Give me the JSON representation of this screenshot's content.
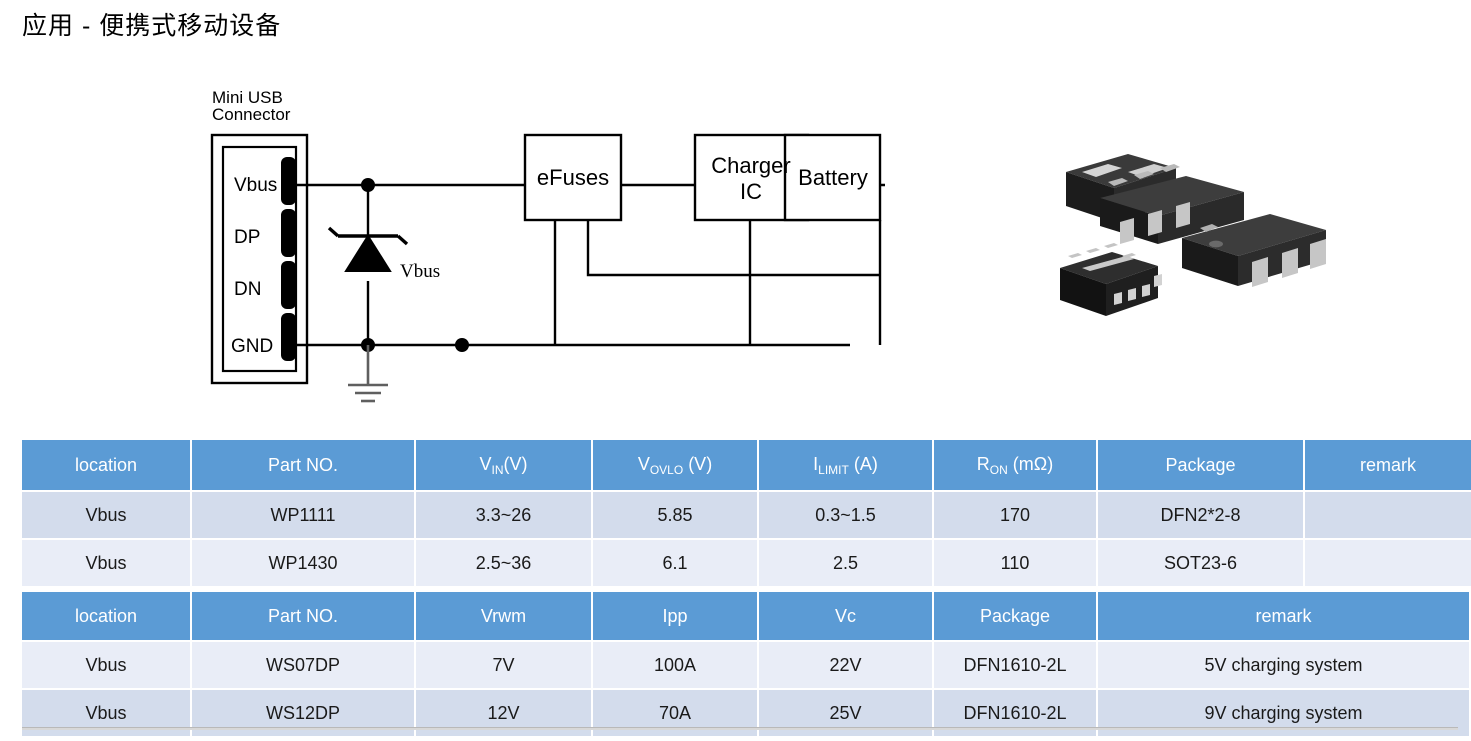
{
  "page": {
    "title": "应用 -  便携式移动设备"
  },
  "schematic": {
    "connector_label_line1": "Mini USB",
    "connector_label_line2": "Connector",
    "pins": [
      "Vbus",
      "DP",
      "DN",
      "GND"
    ],
    "tvs_label": "Vbus",
    "blocks": [
      {
        "name": "efuses",
        "label": "eFuses"
      },
      {
        "name": "charger-ic",
        "label_line1": "Charger",
        "label_line2": "IC"
      },
      {
        "name": "battery",
        "label": "Battery"
      }
    ]
  },
  "packages": [
    {
      "name": "dfn1610-2l-package",
      "type": "dfn-2-lead"
    },
    {
      "name": "dfn2x2-8-package",
      "type": "dfn-8-lead"
    },
    {
      "name": "sot23-6-package-a",
      "type": "sot23-6"
    },
    {
      "name": "sot23-6-package-b",
      "type": "sot23-6"
    }
  ],
  "colors": {
    "header_blue": "#5b9bd5",
    "row_dark": "#d3dcec",
    "row_light": "#e9edf7",
    "rule_gray": "#b9b9b9"
  },
  "table_efuse": {
    "headers": {
      "location": "location",
      "part_no": "Part NO.",
      "vin_main": "V",
      "vin_sub": "IN",
      "vin_tail": "(V)",
      "vovlo_main": "V",
      "vovlo_sub": "OVLO",
      "vovlo_tail": " (V)",
      "ilimit_main": "I",
      "ilimit_sub": "LIMIT",
      "ilimit_tail": " (A)",
      "ron_main": "R",
      "ron_sub": "ON",
      "ron_tail": " (mΩ)",
      "package": "Package",
      "remark": "remark"
    },
    "rows": [
      {
        "location": "Vbus",
        "part_no": "WP1111",
        "vin": "3.3~26",
        "vovlo": "5.85",
        "ilimit": "0.3~1.5",
        "ron": "170",
        "package": "DFN2*2-8",
        "remark": ""
      },
      {
        "location": "Vbus",
        "part_no": "WP1430",
        "vin": "2.5~36",
        "vovlo": "6.1",
        "ilimit": "2.5",
        "ron": "110",
        "package": "SOT23-6",
        "remark": ""
      }
    ]
  },
  "table_tvs": {
    "headers": {
      "location": "location",
      "part_no": "Part NO.",
      "vrwm": "Vrwm",
      "ipp": "Ipp",
      "vc": "Vc",
      "package": "Package",
      "remark": "remark"
    },
    "rows": [
      {
        "location": "Vbus",
        "part_no": "WS07DP",
        "vrwm": "7V",
        "ipp": "100A",
        "vc": "22V",
        "package": "DFN1610-2L",
        "remark": "5V charging system"
      },
      {
        "location": "Vbus",
        "part_no": "WS12DP",
        "vrwm": "12V",
        "ipp": "70A",
        "vc": "25V",
        "package": "DFN1610-2L",
        "remark": "9V charging system"
      }
    ]
  }
}
